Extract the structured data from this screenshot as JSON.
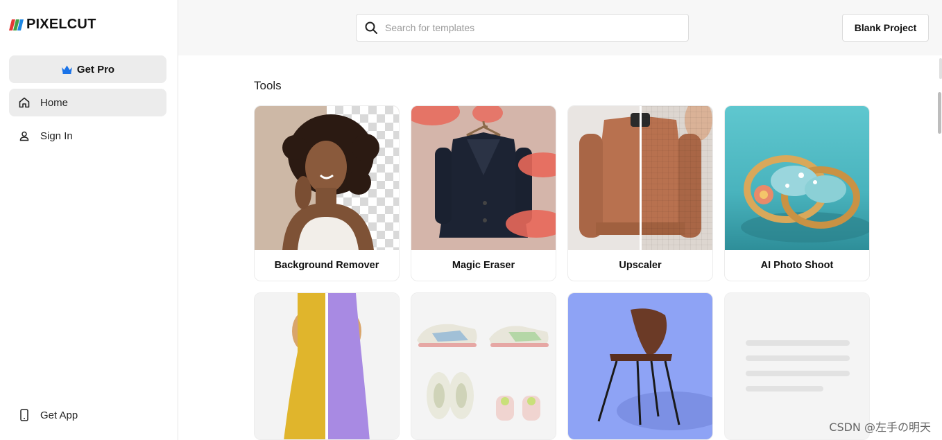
{
  "app": {
    "logo_text": "PIXELCUT"
  },
  "sidebar": {
    "get_pro": "Get Pro",
    "items": [
      {
        "label": "Home",
        "icon": "home-icon",
        "active": true
      },
      {
        "label": "Sign In",
        "icon": "user-icon",
        "active": false
      }
    ],
    "get_app": "Get App"
  },
  "header": {
    "search_placeholder": "Search for templates",
    "blank_project": "Blank Project"
  },
  "main": {
    "section_title": "Tools",
    "tools": [
      {
        "label": "Background Remover"
      },
      {
        "label": "Magic Eraser"
      },
      {
        "label": "Upscaler"
      },
      {
        "label": "AI Photo Shoot"
      }
    ]
  },
  "watermark": "CSDN @左手の明天",
  "colors": {
    "accent": "#1a73e8",
    "sidebar_active": "#ececec",
    "topbar_bg": "#f7f7f7"
  }
}
